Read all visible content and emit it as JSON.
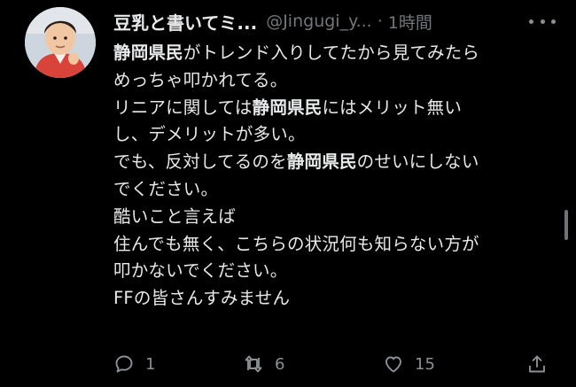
{
  "tweet": {
    "display_name": "豆乳と書いてミ...",
    "handle": "@Jingugi_y...",
    "separator": "·",
    "time": "1時間",
    "lines": [
      [
        {
          "t": "静岡県民",
          "b": true
        },
        {
          "t": "がトレンド入りしてたから見てみたら",
          "b": false
        }
      ],
      [
        {
          "t": "めっちゃ叩かれてる。",
          "b": false
        }
      ],
      [
        {
          "t": "リニアに関しては",
          "b": false
        },
        {
          "t": "静岡県民",
          "b": true
        },
        {
          "t": "にはメリット無い",
          "b": false
        }
      ],
      [
        {
          "t": "し、デメリットが多い。",
          "b": false
        }
      ],
      [
        {
          "t": "でも、反対してるのを",
          "b": false
        },
        {
          "t": "静岡県民",
          "b": true
        },
        {
          "t": "のせいにしない",
          "b": false
        }
      ],
      [
        {
          "t": "でください。",
          "b": false
        }
      ],
      [
        {
          "t": "酷いこと言えば",
          "b": false
        }
      ],
      [
        {
          "t": "住んでも無く、こちらの状況何も知らない方が",
          "b": false
        }
      ],
      [
        {
          "t": "叩かないでください。",
          "b": false
        }
      ],
      [
        {
          "t": "FFの皆さんすみません",
          "b": false
        }
      ]
    ],
    "actions": {
      "reply": {
        "icon": "reply-icon",
        "count": "1"
      },
      "retweet": {
        "icon": "retweet-icon",
        "count": "6"
      },
      "like": {
        "icon": "heart-icon",
        "count": "15"
      },
      "share": {
        "icon": "share-icon"
      }
    }
  },
  "colors": {
    "background": "#000000",
    "text": "#e7e9ea",
    "muted": "#71767b",
    "icon": "#8b9096"
  }
}
